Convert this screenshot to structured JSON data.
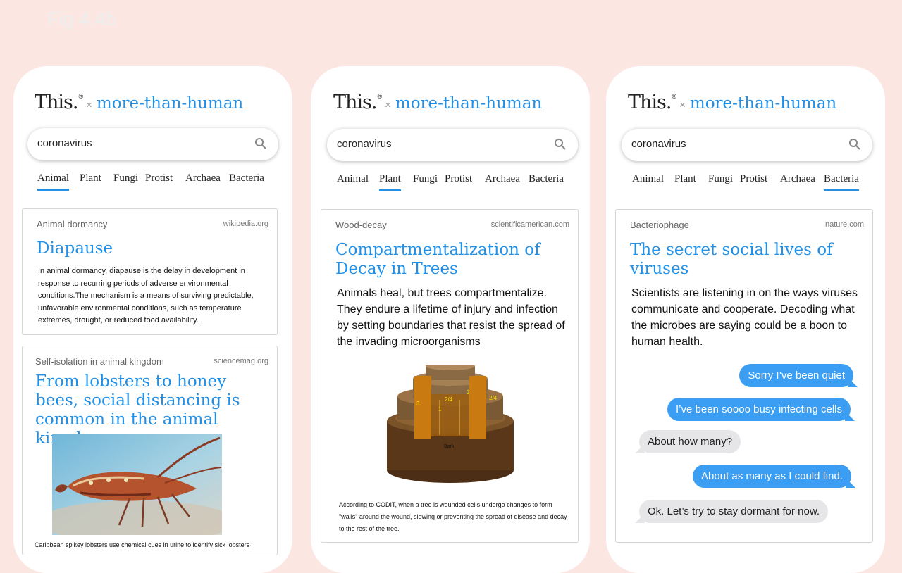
{
  "figure_label": "Fig 4.4b",
  "brand": {
    "name": "This.",
    "mark": "®",
    "separator": "×",
    "tagline": "more-than-human"
  },
  "colors": {
    "accent": "#2190e6",
    "background": "#fbe6e1",
    "bubble_out": "#3c9ef3",
    "bubble_in": "#e6e6e9"
  },
  "tabs": [
    "Animal",
    "Plant",
    "Fungi",
    "Protist",
    "Archaea",
    "Bacteria"
  ],
  "search_icon": "search-icon",
  "phones": [
    {
      "query": "coronavirus",
      "active_tab": "Animal",
      "cards": [
        {
          "category": "Animal dormancy",
          "source": "wikipedia.org",
          "title": "Diapause",
          "body": "In animal dormancy, diapause is the delay in development in response to recurring periods of adverse environmental conditions.The mechanism is a means of surviving predictable, unfavorable environmental conditions, such as temperature extremes, drought, or reduced food availability."
        },
        {
          "category": "Self-isolation in animal kingdom",
          "source": "sciencemag.org",
          "title": "From lobsters to honey bees, social distancing is common in the animal kingdom",
          "caption": "Caribbean spikey lobsters use chemical cues in urine to identify sick lobsters"
        }
      ]
    },
    {
      "query": "coronavirus",
      "active_tab": "Plant",
      "cards": [
        {
          "category": "Wood-decay",
          "source": "scientificamerican.com",
          "title": "Compartmentalization of Decay in Trees",
          "body": "Animals heal, but trees compartmentalize. They endure a lifetime of injury and infection by setting boundaries that resist the spread of the invading microorganisms",
          "diagram_labels": [
            "3",
            "2/4",
            "1",
            "3",
            "2/4",
            "Bark"
          ],
          "caption": "According to CODIT, when a tree is wounded cells undergo changes to form \"walls\" around the wound, slowing or preventing the spread of disease and decay to the rest of the tree."
        }
      ]
    },
    {
      "query": "coronavirus",
      "active_tab": "Bacteria",
      "cards": [
        {
          "category": "Bacteriophage",
          "source": "nature.com",
          "title": "The secret social lives of viruses",
          "body": "Scientists are listening in on the ways viruses communicate and cooperate. Decoding what the microbes are saying could be a boon to human health.",
          "messages": [
            {
              "from": "out",
              "text": "Sorry I’ve been quiet"
            },
            {
              "from": "out",
              "text": "I’ve been soooo busy infecting cells"
            },
            {
              "from": "in",
              "text": "About how many?"
            },
            {
              "from": "out",
              "text": "About as many as I could find."
            },
            {
              "from": "in",
              "text": "Ok. Let’s try to stay dormant for now."
            }
          ]
        }
      ]
    }
  ]
}
